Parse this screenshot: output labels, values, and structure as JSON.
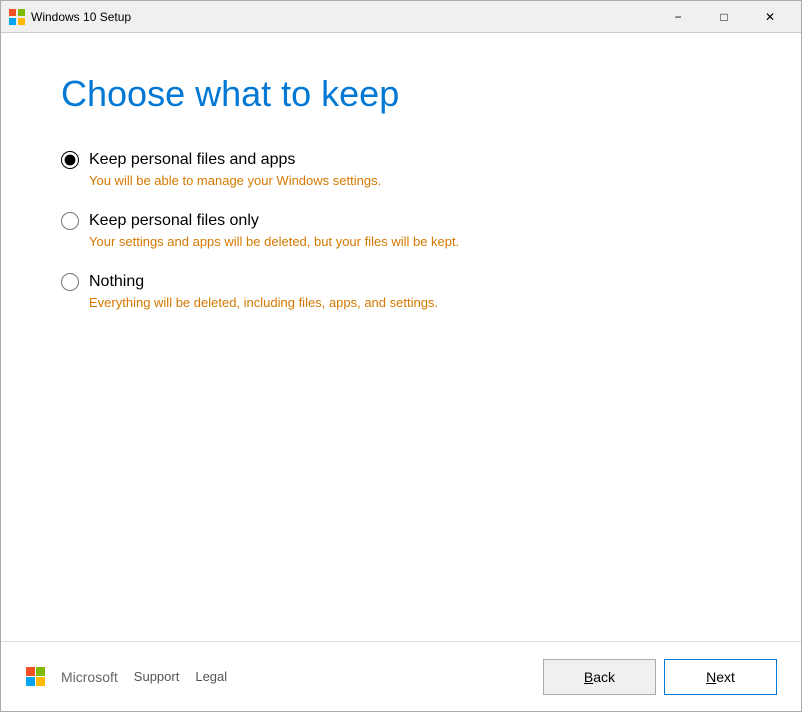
{
  "window": {
    "title": "Windows 10 Setup"
  },
  "titlebar": {
    "minimize_label": "−",
    "maximize_label": "□",
    "close_label": "✕"
  },
  "page": {
    "title": "Choose what to keep"
  },
  "options": [
    {
      "id": "keep-all",
      "label": "Keep personal files and apps",
      "description": "You will be able to manage your Windows settings.",
      "checked": true
    },
    {
      "id": "keep-files",
      "label": "Keep personal files only",
      "description": "Your settings and apps will be deleted, but your files will be kept.",
      "checked": false
    },
    {
      "id": "nothing",
      "label": "Nothing",
      "description": "Everything will be deleted, including files, apps, and settings.",
      "checked": false
    }
  ],
  "footer": {
    "brand": "Microsoft",
    "support_label": "Support",
    "legal_label": "Legal",
    "back_label": "Back",
    "next_label": "Next"
  }
}
